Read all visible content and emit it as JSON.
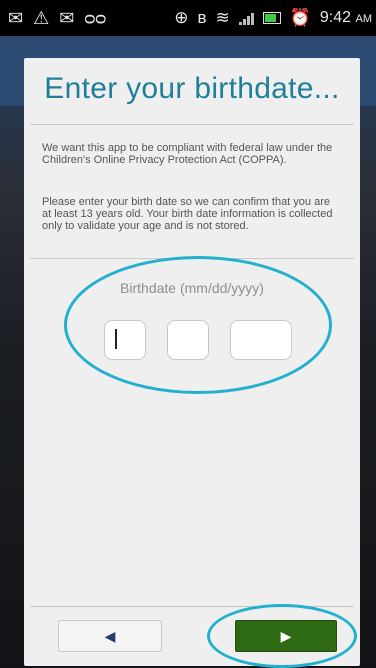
{
  "status_bar": {
    "time": "9:42",
    "ampm": "AM",
    "icons": [
      "email-icon",
      "warning-icon",
      "email-icon",
      "voicemail-icon",
      "gps-icon",
      "bluetooth-icon",
      "wifi-icon",
      "signal-icon",
      "battery-icon",
      "alarm-icon"
    ]
  },
  "dialog": {
    "title": "Enter your birthdate...",
    "paragraph1": "We want this app to be compliant with federal law under the Children's Online Privacy Protection Act (COPPA).",
    "paragraph2": "Please enter your birth date so we can confirm that you are at least 13 years old. Your birth date information is collected only to validate your age and is not stored.",
    "birthdate_label": "Birthdate (mm/dd/yyyy)",
    "fields": {
      "month_value": "",
      "day_value": "",
      "year_value": ""
    }
  },
  "nav": {
    "back_icon": "◀",
    "next_icon": "▶"
  },
  "colors": {
    "title": "#1f7f99",
    "annotation": "#21b1cf",
    "next_button": "#2e6a14"
  }
}
